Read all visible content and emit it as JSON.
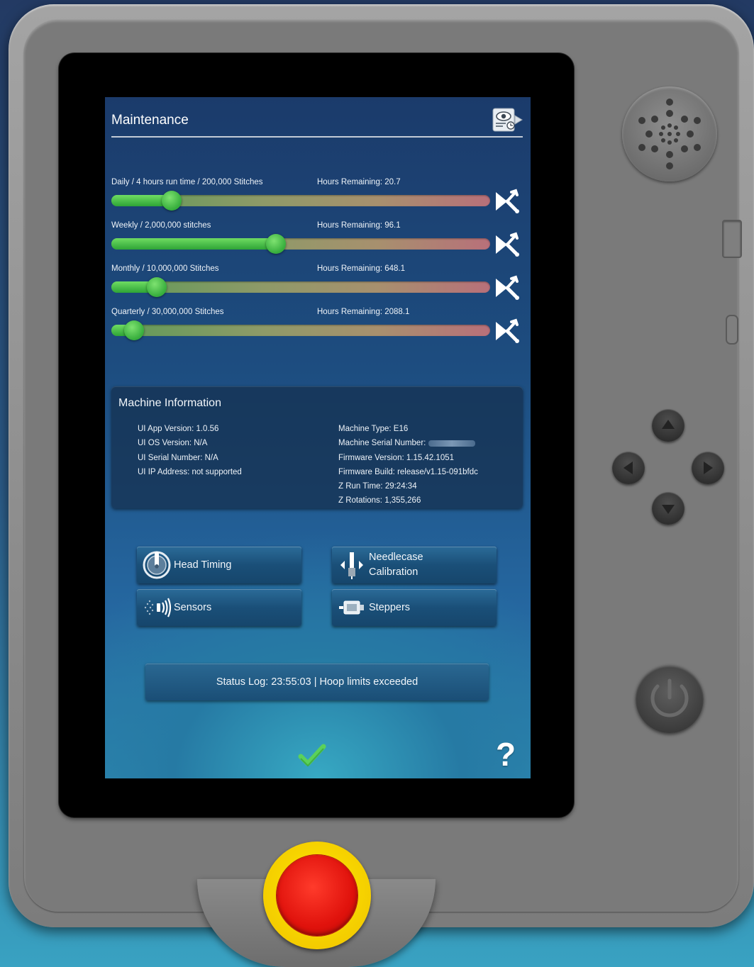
{
  "screen": {
    "title": "Maintenance"
  },
  "maintenance": {
    "items": [
      {
        "label": "Daily / 4 hours run time / 200,000 Stitches",
        "hours": "Hours Remaining: 20.7",
        "progress": 0.16
      },
      {
        "label": "Weekly / 2,000,000 stitches",
        "hours": "Hours Remaining: 96.1",
        "progress": 0.435
      },
      {
        "label": "Monthly / 10,000,000 Stitches",
        "hours": "Hours Remaining: 648.1",
        "progress": 0.12
      },
      {
        "label": "Quarterly / 30,000,000 Stitches",
        "hours": "Hours Remaining: 2088.1",
        "progress": 0.06
      }
    ]
  },
  "machine_info": {
    "title": "Machine Information",
    "left": [
      "UI App Version: 1.0.56",
      "UI OS Version: N/A",
      "UI Serial Number: N/A",
      "UI IP Address: not supported"
    ],
    "serial_label": "Machine Serial Number:",
    "right": [
      "Machine Type: E16",
      "Firmware Version: 1.15.42.1051",
      "Firmware Build: release/v1.15-091bfdc",
      "Z Run Time: 29:24:34",
      "Z Rotations: 1,355,266"
    ]
  },
  "buttons": {
    "head_timing": "Head Timing",
    "needlecase_line1": "Needlecase",
    "needlecase_line2": "Calibration",
    "sensors": "Sensors",
    "steppers": "Steppers"
  },
  "status_log": "Status Log: 23:55:03 | Hoop limits exceeded",
  "help_label": "?",
  "colors": {
    "slider_fill": "#36ad3c",
    "estop_red": "#e0120c",
    "estop_yellow": "#f2c900"
  },
  "icons": [
    "settings-camera-icon",
    "tool-reset-icon",
    "timing-icon",
    "needlecase-icon",
    "sensor-icon",
    "stepper-icon",
    "checkmark-icon",
    "help-icon",
    "power-icon"
  ]
}
